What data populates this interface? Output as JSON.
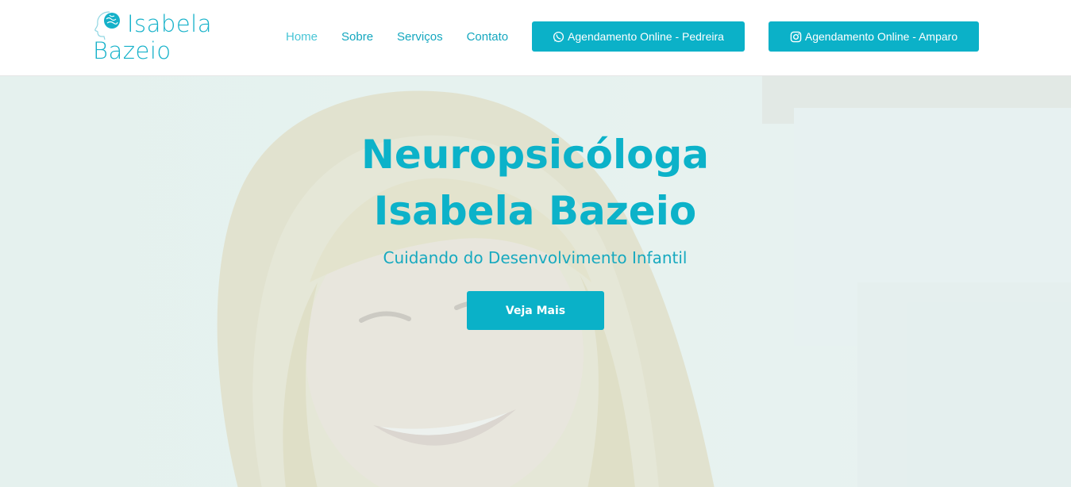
{
  "brand": {
    "name_line1": "Isabela",
    "name_line2": "Bazeio",
    "color": "#14b1c9",
    "logo_icon": "head-brain-icon"
  },
  "nav": {
    "items": [
      {
        "label": "Home",
        "active": true
      },
      {
        "label": "Sobre",
        "active": false
      },
      {
        "label": "Serviços",
        "active": false
      },
      {
        "label": "Contato",
        "active": false
      }
    ]
  },
  "header_buttons": {
    "pedreira": {
      "label": "Agendamento Online - Pedreira",
      "icon": "whatsapp-icon"
    },
    "amparo": {
      "label": "Agendamento Online - Amparo",
      "icon": "instagram-icon"
    }
  },
  "hero": {
    "title_line1": "Neuropsicóloga",
    "title_line2": "Isabela Bazeio",
    "subtitle": "Cuidando do Desenvolvimento Infantil",
    "button_label": "Veja Mais",
    "accent_color": "#0ab1c8"
  }
}
